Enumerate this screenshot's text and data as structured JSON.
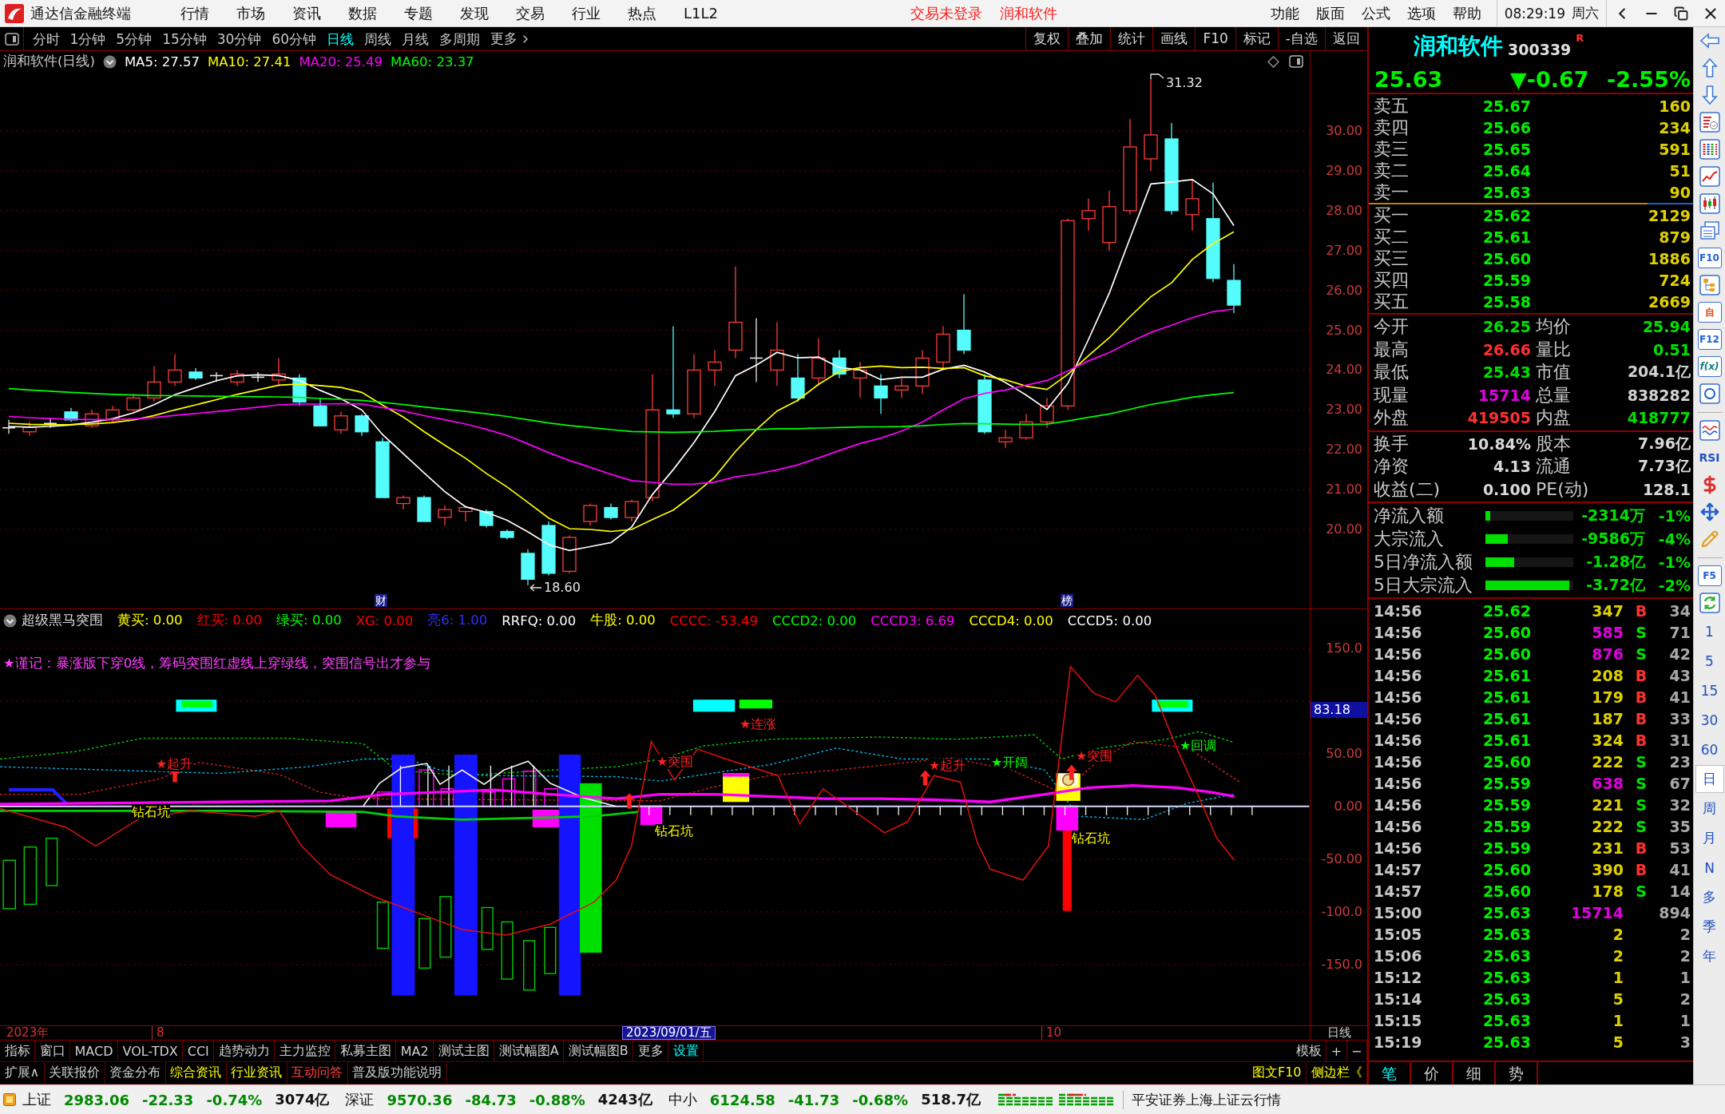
{
  "menu_bar": {
    "app_title": "通达信金融终端",
    "menus": [
      "行情",
      "市场",
      "资讯",
      "数据",
      "专题",
      "发现",
      "交易",
      "行业",
      "热点",
      "L1L2"
    ],
    "alerts": [
      "交易未登录",
      "润和软件"
    ],
    "right_menus": [
      "功能",
      "版面",
      "公式",
      "选项",
      "帮助"
    ],
    "clock": "08:29:19",
    "weekday": "周六"
  },
  "period_bar": {
    "periods": [
      {
        "label": "分时",
        "selected": false
      },
      {
        "label": "1分钟",
        "selected": false
      },
      {
        "label": "5分钟",
        "selected": false
      },
      {
        "label": "15分钟",
        "selected": false
      },
      {
        "label": "30分钟",
        "selected": false
      },
      {
        "label": "60分钟",
        "selected": false
      },
      {
        "label": "日线",
        "selected": true
      },
      {
        "label": "周线",
        "selected": false
      },
      {
        "label": "月线",
        "selected": false
      },
      {
        "label": "多周期",
        "selected": false
      }
    ],
    "more": "更多",
    "tools": [
      "复权",
      "叠加",
      "统计",
      "画线",
      "F10",
      "标记",
      "-自选",
      "返回"
    ]
  },
  "price_chart": {
    "title": "润和软件(日线)",
    "averages": [
      {
        "label": "MA5: 27.57",
        "color": "#ffffff"
      },
      {
        "label": "MA10: 27.41",
        "color": "#ffff00"
      },
      {
        "label": "MA20: 25.49",
        "color": "#ff00ff"
      },
      {
        "label": "MA60: 23.37",
        "color": "#00ff00"
      }
    ],
    "y_ticks": [
      "30.00",
      "29.00",
      "28.00",
      "27.00",
      "26.00",
      "25.00",
      "24.00",
      "23.00",
      "22.00",
      "21.00",
      "20.00"
    ],
    "high_label": "31.32",
    "low_label": "18.60",
    "markers": [
      "财",
      "榜"
    ]
  },
  "indicator": {
    "name": "超级黑马突围",
    "values": [
      {
        "label": "黄买: 0.00",
        "color": "#ffff00"
      },
      {
        "label": "红买: 0.00",
        "color": "#ff0000"
      },
      {
        "label": "绿买: 0.00",
        "color": "#00ff00"
      },
      {
        "label": "XG: 0.00",
        "color": "#ff0000"
      },
      {
        "label": "亮6: 1.00",
        "color": "#3030ff"
      },
      {
        "label": "RRFQ: 0.00",
        "color": "#ffffff"
      },
      {
        "label": "牛股: 0.00",
        "color": "#ffff00"
      },
      {
        "label": "CCCC: -53.49",
        "color": "#ff0000"
      },
      {
        "label": "CCCD2: 0.00",
        "color": "#00ff00"
      },
      {
        "label": "CCCD3: 6.69",
        "color": "#ff00ff"
      },
      {
        "label": "CCCD4: 0.00",
        "color": "#ffff00"
      },
      {
        "label": "CCCD5: 0.00",
        "color": "#ffffff"
      }
    ],
    "note": "★谨记：暴涨版下穿0线，筹码突围红虚线上穿绿线，突围信号出才参与",
    "y_ticks": [
      "150.0",
      "50.00",
      "0.00",
      "-50.00",
      "-100.0",
      "-150.0"
    ],
    "last_value": "83.18",
    "signals": [
      {
        "text": "★起升",
        "color": "#ff2020"
      },
      {
        "text": "钻石坑",
        "color": "#ffff00"
      },
      {
        "text": "★突围",
        "color": "#ff2020"
      },
      {
        "text": "★连涨",
        "color": "#ff2020"
      },
      {
        "text": "钻石坑",
        "color": "#ffff00"
      },
      {
        "text": "★起升",
        "color": "#ff2020"
      },
      {
        "text": "★开阔",
        "color": "#00ff00"
      },
      {
        "text": "★突围",
        "color": "#ff2020"
      },
      {
        "text": "钻石坑",
        "color": "#ffff00"
      },
      {
        "text": "★回调",
        "color": "#00ff00"
      }
    ]
  },
  "timeline": {
    "year": "2023年",
    "months": [
      "8",
      "10"
    ],
    "cursor_date": "2023/09/01/五",
    "period": "日线"
  },
  "indicator_tabs": {
    "items": [
      {
        "label": "指标",
        "color": "#d0d0d0"
      },
      {
        "label": "窗口",
        "color": "#d0d0d0"
      },
      {
        "label": "MACD",
        "color": "#d0d0d0"
      },
      {
        "label": "VOL-TDX",
        "color": "#d0d0d0"
      },
      {
        "label": "CCI",
        "color": "#d0d0d0"
      },
      {
        "label": "趋势动力",
        "color": "#d0d0d0"
      },
      {
        "label": "主力监控",
        "color": "#d0d0d0"
      },
      {
        "label": "私募主图",
        "color": "#d0d0d0"
      },
      {
        "label": "MA2",
        "color": "#d0d0d0"
      },
      {
        "label": "测试主图",
        "color": "#d0d0d0"
      },
      {
        "label": "测试幅图A",
        "color": "#d0d0d0"
      },
      {
        "label": "测试幅图B",
        "color": "#d0d0d0"
      },
      {
        "label": "更多",
        "color": "#d0d0d0"
      },
      {
        "label": "设置",
        "color": "#00ffff"
      }
    ],
    "right_items": [
      "模板",
      "+",
      "−"
    ]
  },
  "extension_bar": {
    "items": [
      {
        "label": "扩展∧",
        "color": "#d0d0d0"
      },
      {
        "label": "关联报价",
        "color": "#d0d0d0"
      },
      {
        "label": "资金分布",
        "color": "#d0d0d0"
      },
      {
        "label": "综合资讯",
        "color": "#ffff00"
      },
      {
        "label": "行业资讯",
        "color": "#ffff00"
      },
      {
        "label": "互动问答",
        "color": "#ff4040"
      },
      {
        "label": "普及版功能说明",
        "color": "#d0d0d0"
      }
    ],
    "right_items": [
      "图文F10",
      "侧边栏《"
    ]
  },
  "quote": {
    "name": "润和软件",
    "code": "300339",
    "flag": "R",
    "price": "25.63",
    "change": "▼-0.67",
    "change_pct": "-2.55%",
    "asks": [
      {
        "label": "卖五",
        "price": "25.67",
        "volume": "160"
      },
      {
        "label": "卖四",
        "price": "25.66",
        "volume": "234"
      },
      {
        "label": "卖三",
        "price": "25.65",
        "volume": "591"
      },
      {
        "label": "卖二",
        "price": "25.64",
        "volume": "51"
      },
      {
        "label": "卖一",
        "price": "25.63",
        "volume": "90"
      }
    ],
    "bids": [
      {
        "label": "买一",
        "price": "25.62",
        "volume": "2129"
      },
      {
        "label": "买二",
        "price": "25.61",
        "volume": "879"
      },
      {
        "label": "买三",
        "price": "25.60",
        "volume": "1886"
      },
      {
        "label": "买四",
        "price": "25.59",
        "volume": "724"
      },
      {
        "label": "买五",
        "price": "25.58",
        "volume": "2669"
      }
    ],
    "stats": [
      {
        "label": "今开",
        "value": "26.25",
        "color": "#00e000"
      },
      {
        "label": "均价",
        "value": "25.94",
        "color": "#00e000"
      },
      {
        "label": "最高",
        "value": "26.66",
        "color": "#ff3030"
      },
      {
        "label": "量比",
        "value": "0.51",
        "color": "#00e000"
      },
      {
        "label": "最低",
        "value": "25.43",
        "color": "#00e000"
      },
      {
        "label": "市值",
        "value": "204.1亿",
        "color": "#d0d0d0"
      },
      {
        "label": "现量",
        "value": "15714",
        "color": "#e000e0"
      },
      {
        "label": "总量",
        "value": "838282",
        "color": "#d0d0d0"
      },
      {
        "label": "外盘",
        "value": "419505",
        "color": "#ff3030"
      },
      {
        "label": "内盘",
        "value": "418777",
        "color": "#00e000"
      }
    ],
    "fundamentals": [
      {
        "label": "换手",
        "value": "10.84%"
      },
      {
        "label": "股本",
        "value": "7.96亿"
      },
      {
        "label": "净资",
        "value": "4.13"
      },
      {
        "label": "流通",
        "value": "7.73亿"
      },
      {
        "label": "收益(二)",
        "value": "0.100"
      },
      {
        "label": "PE(动)",
        "value": "128.1"
      }
    ],
    "flows": [
      {
        "label": "净流入额",
        "level": 0.055,
        "value": "-2314万",
        "pct": "-1%"
      },
      {
        "label": "大宗流入",
        "level": 0.25,
        "value": "-9586万",
        "pct": "-4%"
      },
      {
        "label": "5日净流入额",
        "level": 0.33,
        "value": "-1.28亿",
        "pct": "-1%"
      },
      {
        "label": "5日大宗流入",
        "level": 0.95,
        "value": "-3.72亿",
        "pct": "-2%"
      }
    ],
    "ticks": [
      {
        "time": "14:56",
        "price": "25.62",
        "volume": "347",
        "side": "B",
        "count": "34",
        "kind": "buy",
        "large": false
      },
      {
        "time": "14:56",
        "price": "25.60",
        "volume": "585",
        "side": "S",
        "count": "71",
        "kind": "sell",
        "large": true
      },
      {
        "time": "14:56",
        "price": "25.60",
        "volume": "876",
        "side": "S",
        "count": "42",
        "kind": "sell",
        "large": true
      },
      {
        "time": "14:56",
        "price": "25.61",
        "volume": "208",
        "side": "B",
        "count": "43",
        "kind": "buy",
        "large": false
      },
      {
        "time": "14:56",
        "price": "25.61",
        "volume": "179",
        "side": "B",
        "count": "41",
        "kind": "buy",
        "large": false
      },
      {
        "time": "14:56",
        "price": "25.61",
        "volume": "187",
        "side": "B",
        "count": "33",
        "kind": "buy",
        "large": false
      },
      {
        "time": "14:56",
        "price": "25.61",
        "volume": "324",
        "side": "B",
        "count": "31",
        "kind": "buy",
        "large": false
      },
      {
        "time": "14:56",
        "price": "25.60",
        "volume": "222",
        "side": "S",
        "count": "23",
        "kind": "sell",
        "large": false
      },
      {
        "time": "14:56",
        "price": "25.59",
        "volume": "638",
        "side": "S",
        "count": "67",
        "kind": "sell",
        "large": true
      },
      {
        "time": "14:56",
        "price": "25.59",
        "volume": "221",
        "side": "S",
        "count": "32",
        "kind": "sell",
        "large": false
      },
      {
        "time": "14:56",
        "price": "25.59",
        "volume": "222",
        "side": "S",
        "count": "35",
        "kind": "sell",
        "large": false
      },
      {
        "time": "14:56",
        "price": "25.59",
        "volume": "231",
        "side": "B",
        "count": "53",
        "kind": "buy",
        "large": false
      },
      {
        "time": "14:57",
        "price": "25.60",
        "volume": "390",
        "side": "B",
        "count": "41",
        "kind": "buy",
        "large": false
      },
      {
        "time": "14:57",
        "price": "25.60",
        "volume": "178",
        "side": "S",
        "count": "14",
        "kind": "sell",
        "large": false
      },
      {
        "time": "15:00",
        "price": "25.63",
        "volume": "15714",
        "count": "894",
        "kind": "none",
        "large": true
      },
      {
        "time": "15:05",
        "price": "25.63",
        "volume": "2",
        "count": "2",
        "kind": "none",
        "large": false
      },
      {
        "time": "15:06",
        "price": "25.63",
        "volume": "2",
        "count": "2",
        "kind": "none",
        "large": false
      },
      {
        "time": "15:12",
        "price": "25.63",
        "volume": "1",
        "count": "1",
        "kind": "none",
        "large": false
      },
      {
        "time": "15:14",
        "price": "25.63",
        "volume": "5",
        "count": "2",
        "kind": "none",
        "large": false
      },
      {
        "time": "15:15",
        "price": "25.63",
        "volume": "1",
        "count": "1",
        "kind": "none",
        "large": false
      },
      {
        "time": "15:19",
        "price": "25.63",
        "volume": "5",
        "count": "3",
        "kind": "none",
        "large": false
      }
    ],
    "tabs": [
      {
        "label": "笔",
        "selected": true
      },
      {
        "label": "价",
        "selected": false
      },
      {
        "label": "细",
        "selected": false
      },
      {
        "label": "势",
        "selected": false
      }
    ]
  },
  "sidebar": {
    "tiles": [
      {
        "label": "F10",
        "kind": "tile",
        "color": "#2060d0"
      },
      {
        "label": "自",
        "kind": "tile",
        "color": "#e05010"
      },
      {
        "label": "F12",
        "kind": "tile",
        "color": "#2060d0"
      },
      {
        "label": "f(x)",
        "kind": "tile",
        "color": "#108080"
      },
      {
        "label": "RSI",
        "kind": "plain",
        "color": "#2050c0"
      },
      {
        "label": "F5",
        "kind": "tile",
        "color": "#2060d0"
      }
    ],
    "periods": [
      {
        "label": "1",
        "selected": false
      },
      {
        "label": "5",
        "selected": false
      },
      {
        "label": "15",
        "selected": false
      },
      {
        "label": "30",
        "selected": false
      },
      {
        "label": "60",
        "selected": false
      },
      {
        "label": "日",
        "selected": true
      },
      {
        "label": "周",
        "selected": false
      },
      {
        "label": "月",
        "selected": false
      },
      {
        "label": "N",
        "selected": false
      },
      {
        "label": "多",
        "selected": false
      },
      {
        "label": "季",
        "selected": false
      },
      {
        "label": "年",
        "selected": false
      }
    ]
  },
  "status_bar": {
    "indices": [
      {
        "name": "上证",
        "value": "2983.06",
        "change": "-22.33",
        "pct": "-0.74%",
        "amount": "3074亿"
      },
      {
        "name": "深证",
        "value": "9570.36",
        "change": "-84.73",
        "pct": "-0.88%",
        "amount": "4243亿"
      },
      {
        "name": "中小",
        "value": "6124.58",
        "change": "-41.73",
        "pct": "-0.68%",
        "amount": "518.7亿"
      }
    ],
    "feed": "平安证券上海上证云行情"
  }
}
